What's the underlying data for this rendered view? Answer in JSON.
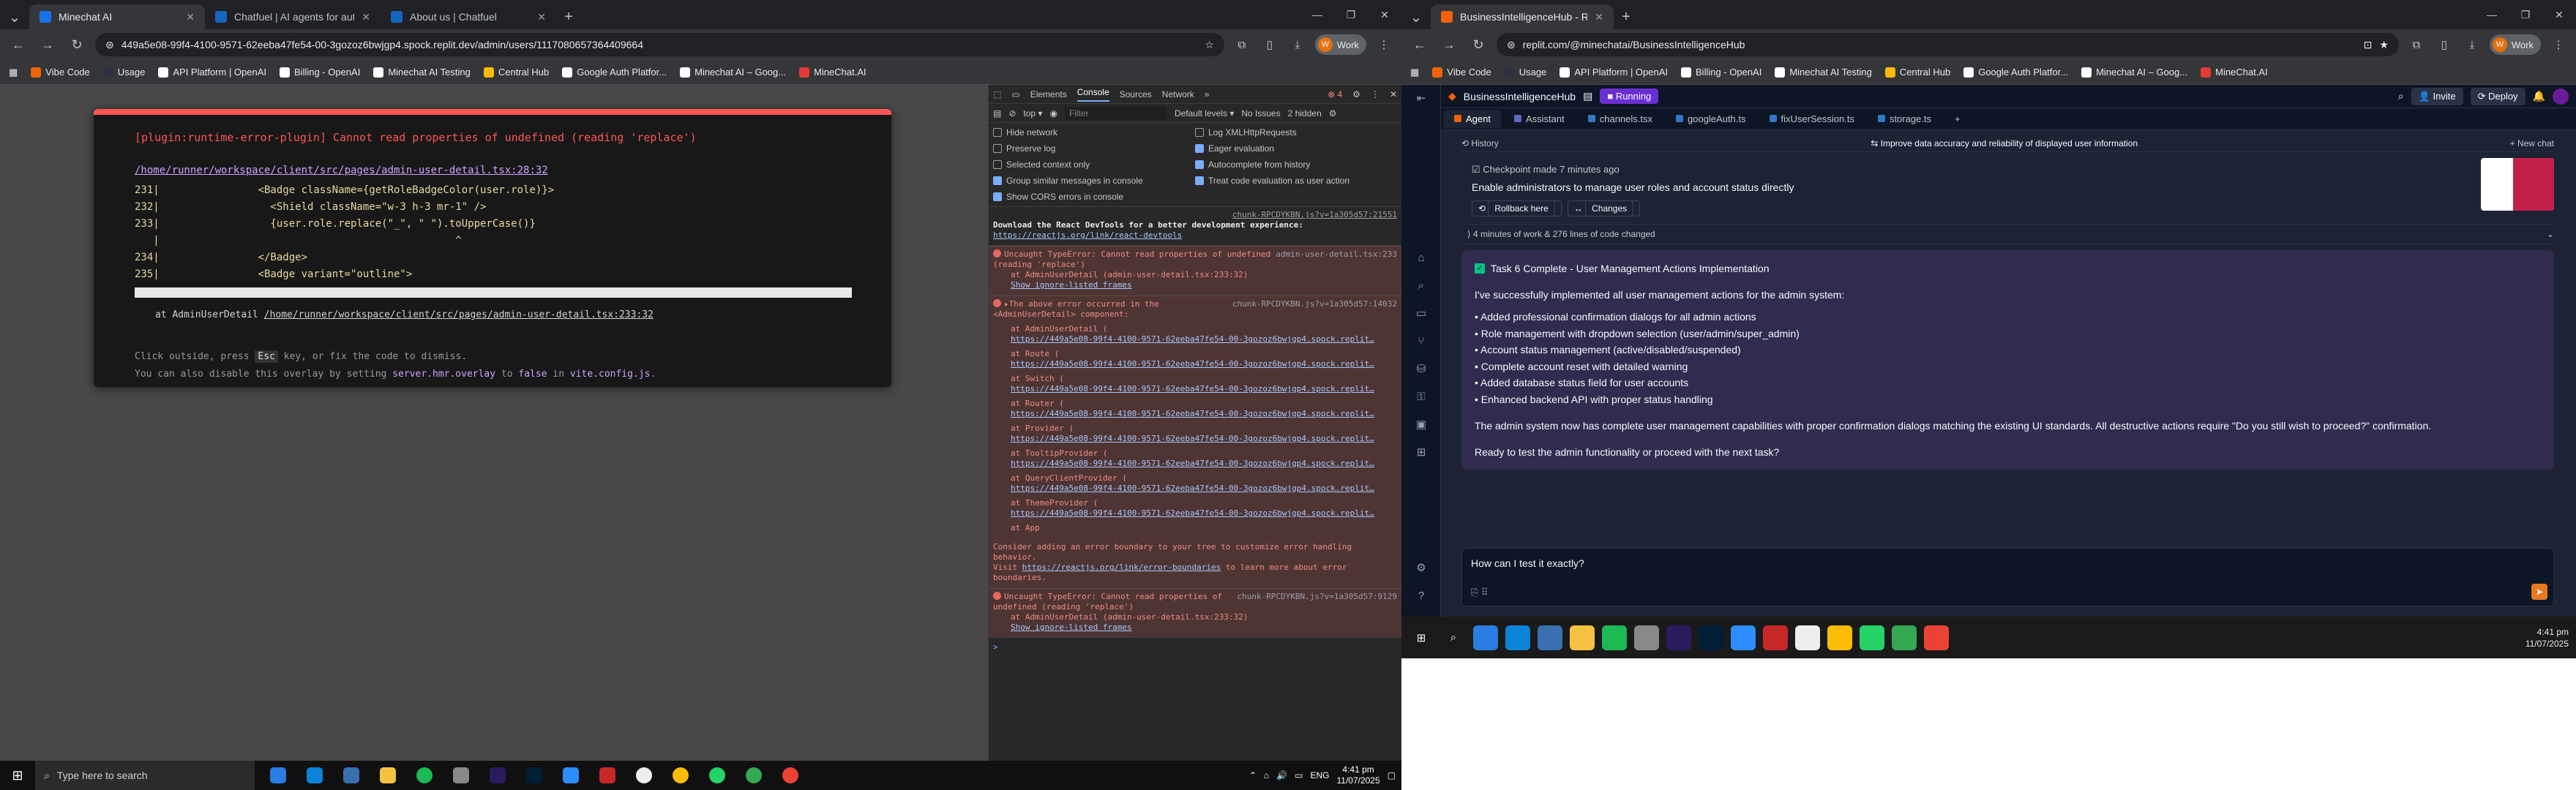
{
  "left_browser": {
    "tabs": [
      {
        "title": "Minechat AI",
        "color": "#1a73e8"
      },
      {
        "title": "Chatfuel | AI agents for automa",
        "color": "#1565c0"
      },
      {
        "title": "About us | Chatfuel",
        "color": "#1565c0"
      }
    ],
    "url": "449a5e08-99f4-4100-9571-62eeba47fe54-00-3gozoz6bwjgp4.spock.replit.dev/admin/users/1117080657364409664",
    "profile": "Work",
    "bookmarks": [
      "Vibe Code",
      "Usage",
      "API Platform | OpenAI",
      "Billing - OpenAI",
      "Minechat AI Testing",
      "Central Hub",
      "Google Auth Platfor...",
      "Minechat AI – Goog...",
      "MineChat.AI"
    ],
    "overlay": {
      "title": "[plugin:runtime-error-plugin] Cannot read properties of undefined (reading 'replace')",
      "file": "/home/runner/workspace/client/src/pages/admin-user-detail.tsx:28:32",
      "code_lines": [
        "231|                <Badge className={getRoleBadgeColor(user.role)}>",
        "232|                  <Shield className=\"w-3 h-3 mr-1\" />",
        "233|                  {user.role.replace(\"_\", \" \").toUpperCase()}",
        "   |                                                ^",
        "234|                </Badge>",
        "235|                <Badge variant=\"outline\">"
      ],
      "at_prefix": "at AdminUserDetail ",
      "at_path": "/home/runner/workspace/client/src/pages/admin-user-detail.tsx:233:32",
      "tip1_a": "Click outside, press ",
      "tip1_key": "Esc",
      "tip1_b": " key, or fix the code to dismiss.",
      "tip2_a": "You can also disable this overlay by setting ",
      "tip2_code": "server.hmr.overlay",
      "tip2_b": " to ",
      "tip2_false": "false",
      "tip2_c": " in ",
      "tip2_file": "vite.config.js",
      "tip2_d": "."
    }
  },
  "devtools": {
    "tabs": [
      "Elements",
      "Console",
      "Sources",
      "Network"
    ],
    "active_tab": "Console",
    "error_count": "4",
    "context": "top",
    "filter_placeholder": "Filter",
    "levels": "Default levels",
    "issues": "No Issues",
    "hidden": "2 hidden",
    "settings": [
      {
        "label": "Hide network",
        "checked": false
      },
      {
        "label": "Log XMLHttpRequests",
        "checked": false
      },
      {
        "label": "Preserve log",
        "checked": false
      },
      {
        "label": "Eager evaluation",
        "checked": true
      },
      {
        "label": "Selected context only",
        "checked": false
      },
      {
        "label": "Autocomplete from history",
        "checked": true
      },
      {
        "label": "Group similar messages in console",
        "checked": true
      },
      {
        "label": "Treat code evaluation as user action",
        "checked": true
      },
      {
        "label": "Show CORS errors in console",
        "checked": true
      }
    ],
    "messages": [
      {
        "source": "chunk-RPCDYKBN.js?v=1a305d57:21551",
        "text": "Download the React DevTools for a better development experience:",
        "link": "https://reactjs.org/link/react-devtools",
        "error": false
      },
      {
        "source": "admin-user-detail.tsx:233",
        "text": "Uncaught TypeError: Cannot read properties of undefined (reading 'replace')",
        "at": "at AdminUserDetail (admin-user-detail.tsx:233:32)",
        "ignore": "Show ignore-listed frames",
        "error": true
      },
      {
        "source": "chunk-RPCDYKBN.js?v=1a305d57:14032",
        "text": "The above error occurred in the <AdminUserDetail> component:",
        "error": true,
        "stack": [
          {
            "at": "at AdminUserDetail (",
            "url": "https://449a5e08-99f4-4100-9571-62eeba47fe54-00-3gozoz6bwjgp4.spock.replit…"
          },
          {
            "at": "at Route (",
            "url": "https://449a5e08-99f4-4100-9571-62eeba47fe54-00-3gozoz6bwjgp4.spock.replit…"
          },
          {
            "at": "at Switch (",
            "url": "https://449a5e08-99f4-4100-9571-62eeba47fe54-00-3gozoz6bwjgp4.spock.replit…"
          },
          {
            "at": "at Router (",
            "url": "https://449a5e08-99f4-4100-9571-62eeba47fe54-00-3gozoz6bwjgp4.spock.replit…"
          },
          {
            "at": "at Provider (",
            "url": "https://449a5e08-99f4-4100-9571-62eeba47fe54-00-3gozoz6bwjgp4.spock.replit…"
          },
          {
            "at": "at TooltipProvider (",
            "url": "https://449a5e08-99f4-4100-9571-62eeba47fe54-00-3gozoz6bwjgp4.spock.replit…"
          },
          {
            "at": "at QueryClientProvider (",
            "url": "https://449a5e08-99f4-4100-9571-62eeba47fe54-00-3gozoz6bwjgp4.spock.replit…"
          },
          {
            "at": "at ThemeProvider (",
            "url": "https://449a5e08-99f4-4100-9571-62eeba47fe54-00-3gozoz6bwjgp4.spock.replit…"
          },
          {
            "at": "at App",
            "url": ""
          }
        ],
        "footer_a": "Consider adding an error boundary to your tree to customize error handling behavior.",
        "footer_b": "Visit ",
        "footer_link": "https://reactjs.org/link/error-boundaries",
        "footer_c": " to learn more about error boundaries."
      },
      {
        "source": "chunk-RPCDYKBN.js?v=1a305d57:9129",
        "text": "Uncaught TypeError: Cannot read properties of undefined (reading 'replace')",
        "at": "at AdminUserDetail (admin-user-detail.tsx:233:32)",
        "ignore": "Show ignore-listed frames",
        "error": true
      }
    ],
    "prompt": ">"
  },
  "right_browser": {
    "tab_title": "BusinessIntelligenceHub - Repli",
    "url": "replit.com/@minechatai/BusinessIntelligenceHub",
    "profile": "Work",
    "bookmarks": [
      "Vibe Code",
      "Usage",
      "API Platform | OpenAI",
      "Billing - OpenAI",
      "Minechat AI Testing",
      "Central Hub",
      "Google Auth Platfor...",
      "Minechat AI – Goog...",
      "MineChat.AI"
    ],
    "replit": {
      "project": "BusinessIntelligenceHub",
      "status": "Running",
      "invite": "Invite",
      "deploy": "Deploy",
      "tabs": [
        {
          "label": "Agent",
          "color": "#f26207"
        },
        {
          "label": "Assistant",
          "color": "#5c6bc0"
        },
        {
          "label": "channels.tsx",
          "color": "#3178c6"
        },
        {
          "label": "googleAuth.ts",
          "color": "#3178c6"
        },
        {
          "label": "fixUserSession.ts",
          "color": "#3178c6"
        },
        {
          "label": "storage.ts",
          "color": "#3178c6"
        }
      ],
      "history": "History",
      "history_title": "Improve data accuracy and reliability of displayed user information",
      "new_chat": "+ New chat",
      "checkpoint": "Checkpoint made 7 minutes ago",
      "checkpoint_desc": "Enable administrators to manage user roles and account status directly",
      "rollback": "Rollback here",
      "changes": "Changes",
      "work_summary": "4 minutes of work & 276 lines of code changed",
      "task_title": "Task 6 Complete - User Management Actions Implementation",
      "task_intro": "I've successfully implemented all user management actions for the admin system:",
      "task_items": [
        "• Added professional confirmation dialogs for all admin actions",
        "• Role management with dropdown selection (user/admin/super_admin)",
        "• Account status management (active/disabled/suspended)",
        "• Complete account reset with detailed warning",
        "• Added database status field for user accounts",
        "• Enhanced backend API with proper status handling"
      ],
      "task_summary": "The admin system now has complete user management capabilities with proper confirmation dialogs matching the existing UI standards. All destructive actions require \"Do you still wish to proceed?\" confirmation.",
      "task_question": "Ready to test the admin functionality or proceed with the next task?",
      "input_value": "How can I test it exactly?"
    },
    "clock_time": "4:41 pm",
    "clock_date": "11/07/2025"
  },
  "taskbar": {
    "search_placeholder": "Type here to search",
    "lang": "ENG",
    "time": "4:41 pm",
    "date": "11/07/2025"
  }
}
